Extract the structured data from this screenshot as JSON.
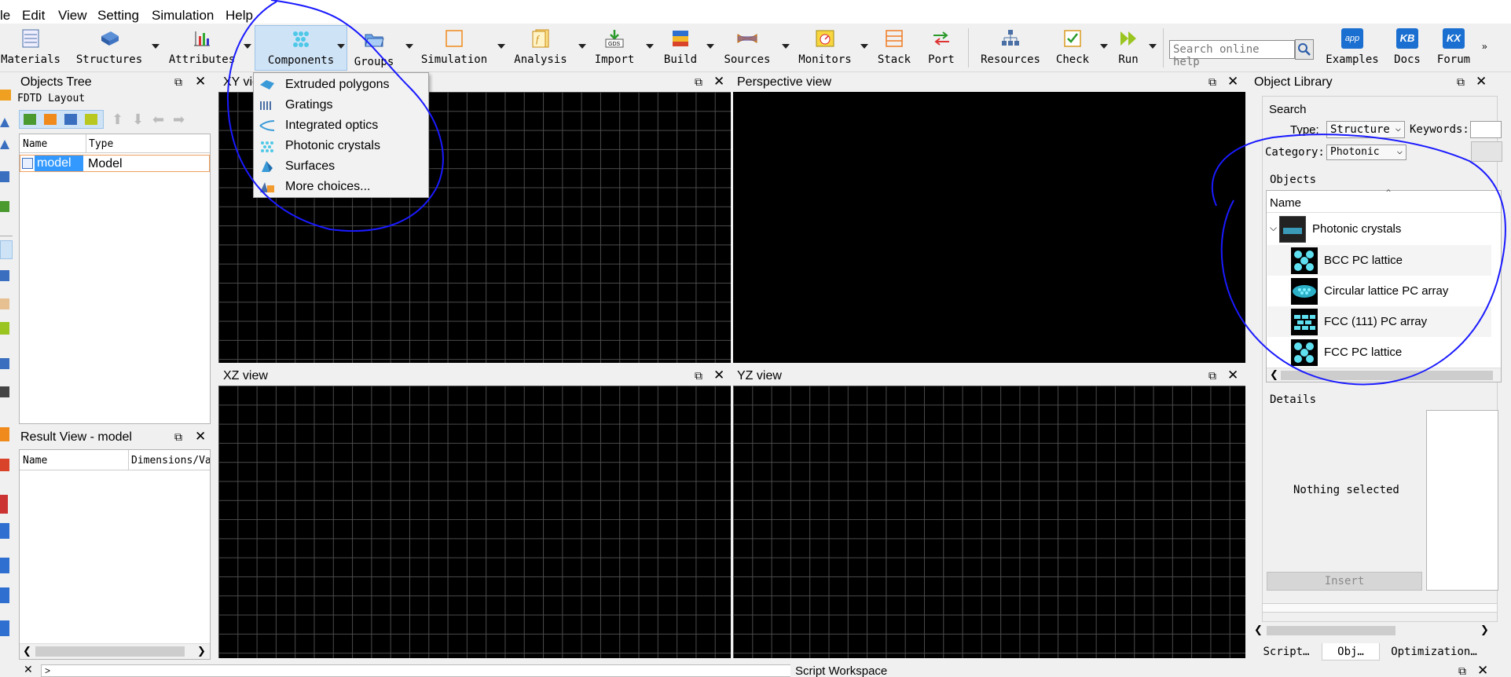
{
  "menubar": {
    "items": [
      "le",
      "Edit",
      "View",
      "Setting",
      "Simulation",
      "Help"
    ]
  },
  "toolbar": {
    "materials": "Materials",
    "structures": "Structures",
    "attributes": "Attributes",
    "components": "Components",
    "groups": "Groups",
    "simulation": "Simulation",
    "analysis": "Analysis",
    "import": "Import",
    "build": "Build",
    "sources": "Sources",
    "monitors": "Monitors",
    "stack": "Stack",
    "port": "Port",
    "resources": "Resources",
    "check": "Check",
    "run": "Run",
    "search_placeholder": "Search online help",
    "examples": "Examples",
    "docs": "Docs",
    "forum": "Forum",
    "examples_badge": "app",
    "docs_badge": "KB",
    "forum_badge": "KX",
    "import_badge": "GDS"
  },
  "components_menu": {
    "items": [
      "Extruded polygons",
      "Gratings",
      "Integrated optics",
      "Photonic crystals",
      "Surfaces",
      "More choices..."
    ]
  },
  "objects_tree": {
    "title": "Objects Tree",
    "subtitle": "FDTD Layout",
    "col_name": "Name",
    "col_type": "Type",
    "row_name": "model",
    "row_type": "Model"
  },
  "result_view": {
    "title": "Result View - model",
    "col_name": "Name",
    "col_dims": "Dimensions/Va"
  },
  "views": {
    "xy": "XY vie",
    "perspective": "Perspective view",
    "xz": "XZ view",
    "yz": "YZ view"
  },
  "object_library": {
    "title": "Object Library",
    "search_label": "Search",
    "type_label": "Type:",
    "type_value": "Structure",
    "keywords_label": "Keywords:",
    "category_label": "Category:",
    "category_value": "Photonic",
    "objects_label": "Objects",
    "col_name": "Name",
    "group": "Photonic crystals",
    "items": [
      "BCC PC lattice",
      "Circular lattice PC array",
      "FCC (111) PC array",
      "FCC PC lattice"
    ],
    "details_label": "Details",
    "nothing_selected": "Nothing selected",
    "insert": "Insert"
  },
  "bottom": {
    "script_tab": "Script…",
    "obj_tab": "Obj…",
    "optim_tab": "Optimization…",
    "script_workspace": "Script Workspace",
    "prompt": ">"
  },
  "colors": {
    "accent": "#0c5fd0",
    "annotation": "#1a1aff",
    "selection": "#3399ff"
  }
}
